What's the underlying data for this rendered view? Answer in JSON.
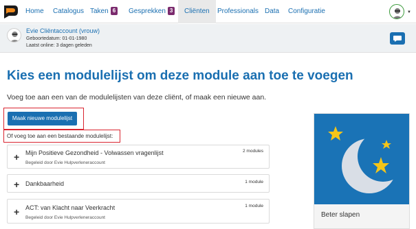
{
  "nav": {
    "items": [
      {
        "label": "Home"
      },
      {
        "label": "Catalogus"
      },
      {
        "label": "Taken",
        "badge": "6"
      },
      {
        "label": "Gesprekken",
        "badge": "3"
      },
      {
        "label": "Cliënten",
        "active": true
      },
      {
        "label": "Professionals"
      },
      {
        "label": "Data"
      },
      {
        "label": "Configuratie"
      }
    ]
  },
  "client": {
    "name": "Evie Cliëntaccount (vrouw)",
    "dob": "Geboortedatum: 01-01-1980",
    "last_online": "Laatst online: 3 dagen geleden"
  },
  "main": {
    "title": "Kies een modulelijst om deze module aan toe te voegen",
    "intro": "Voeg toe aan een van de modulelijsten van deze cliënt, of maak een nieuwe aan.",
    "new_button": "Maak nieuwe modulelijst",
    "or_text": "Of voeg toe aan een bestaande modulelijst:",
    "modules": [
      {
        "title": "Mijn Positieve Gezondheid - Volwassen vragenlijst",
        "sub": "Begeleid door Evie Hulpverleneraccount",
        "count": "2 modules"
      },
      {
        "title": "Dankbaarheid",
        "sub": "",
        "count": "1 module"
      },
      {
        "title": "ACT: van Klacht naar Veerkracht",
        "sub": "Begeleid door Evie Hulpverleneraccount",
        "count": "1 module"
      }
    ]
  },
  "side_card": {
    "title": "Beter slapen"
  },
  "colors": {
    "accent": "#1a6fb1",
    "badge": "#7b2b6e",
    "highlight": "#d9232e",
    "star": "#f5c518"
  }
}
